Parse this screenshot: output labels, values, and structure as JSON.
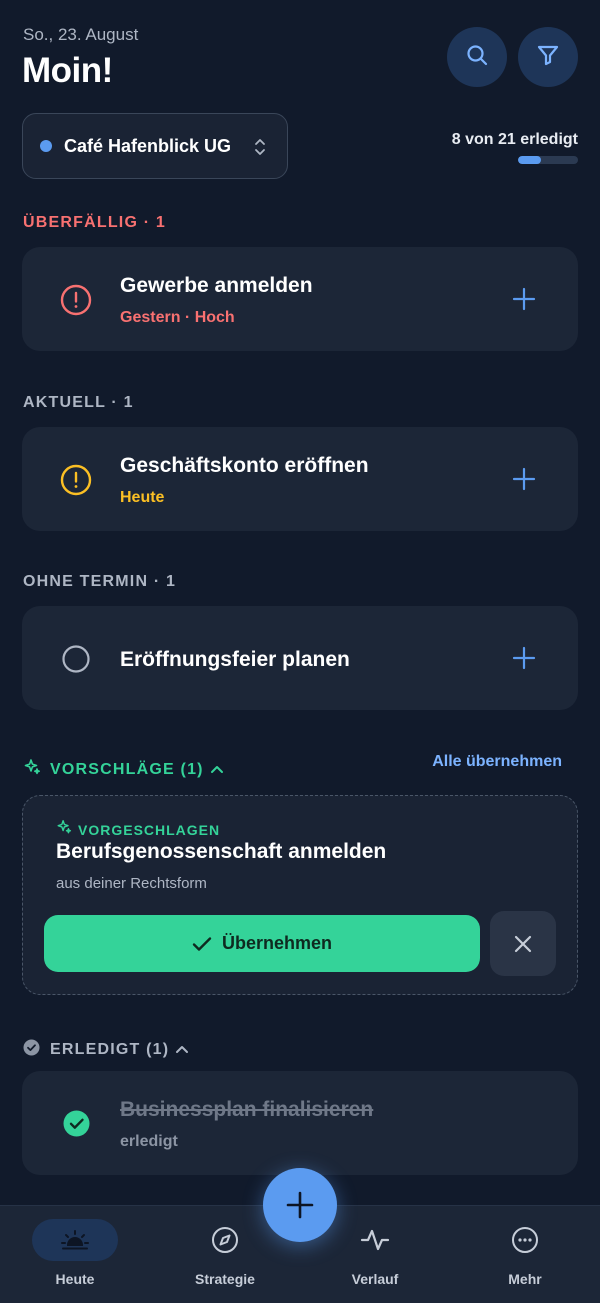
{
  "header": {
    "date": "So., 23. August",
    "greeting": "Moin!",
    "search_icon": "search-icon",
    "filter_icon": "filter-icon"
  },
  "company": {
    "name": "Café Hafenblick UG",
    "dot_color": "#5b9bf0"
  },
  "progress": {
    "text": "8 von 21 erledigt",
    "done": 8,
    "total": 21
  },
  "sections": {
    "overdue": {
      "label": "ÜBERFÄLLIG · 1",
      "color": "#f87171"
    },
    "current": {
      "label": "AKTUELL · 1"
    },
    "no_date": {
      "label": "OHNE TERMIN · 1"
    }
  },
  "tasks": [
    {
      "title": "Gewerbe anmelden",
      "meta": "Gestern · Hoch",
      "meta_color": "#f87171",
      "icon": "alert-circle-icon"
    },
    {
      "title": "Geschäftskonto eröffnen",
      "meta": "Heute",
      "meta_color": "#fbbf24",
      "icon": "alert-circle-icon"
    },
    {
      "title": "Eröffnungsfeier planen",
      "meta": "",
      "icon": "empty-circle-icon"
    }
  ],
  "suggestions": {
    "label": "VORSCHLÄGE (1)",
    "accept_all": "Alle übernehmen",
    "item": {
      "tag": "VORGESCHLAGEN",
      "title": "Berufsgenossenschaft anmelden",
      "source": "aus deiner Rechtsform",
      "accept_label": "Übernehmen"
    },
    "accent": "#34d399"
  },
  "done": {
    "label": "ERLEDIGT (1)",
    "items": [
      {
        "title": "Businessplan finalisieren",
        "status": "erledigt"
      }
    ]
  },
  "tabbar": {
    "tabs": [
      {
        "label": "Heute",
        "icon": "sunrise-icon",
        "active": true
      },
      {
        "label": "Strategie",
        "icon": "compass-icon",
        "active": false
      },
      {
        "label": "Verlauf",
        "icon": "activity-icon",
        "active": false
      },
      {
        "label": "Mehr",
        "icon": "more-circle-icon",
        "active": false
      }
    ]
  }
}
